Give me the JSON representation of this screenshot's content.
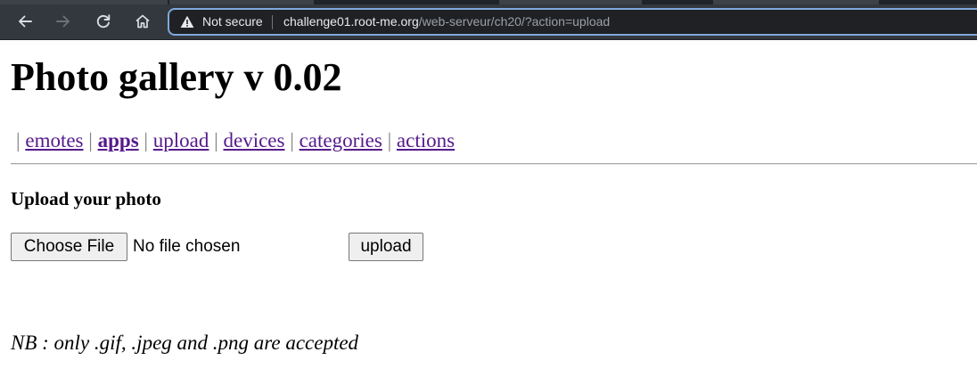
{
  "browser": {
    "security_label": "Not secure",
    "url_host": "challenge01.root-me.org",
    "url_path": "/web-serveur/ch20/?action=upload",
    "icons": [
      "back-arrow-icon",
      "forward-arrow-icon",
      "reload-icon",
      "home-icon",
      "warning-icon"
    ]
  },
  "page": {
    "title": "Photo gallery v 0.02",
    "nav": {
      "separator": "|",
      "items": [
        {
          "label": "emotes",
          "current": false
        },
        {
          "label": "apps",
          "current": true
        },
        {
          "label": "upload",
          "current": false
        },
        {
          "label": "devices",
          "current": false
        },
        {
          "label": "categories",
          "current": false
        },
        {
          "label": "actions",
          "current": false
        }
      ]
    },
    "upload": {
      "heading": "Upload your photo",
      "choose_file_label": "Choose File",
      "file_status": "No file chosen",
      "submit_label": "upload"
    },
    "note": "NB : only .gif, .jpeg and .png are accepted"
  },
  "colors": {
    "chrome_bg": "#33383f",
    "omnibox_bg": "#202124",
    "omnibox_focus": "#7fa9dd",
    "visited_link": "#551a8b"
  }
}
